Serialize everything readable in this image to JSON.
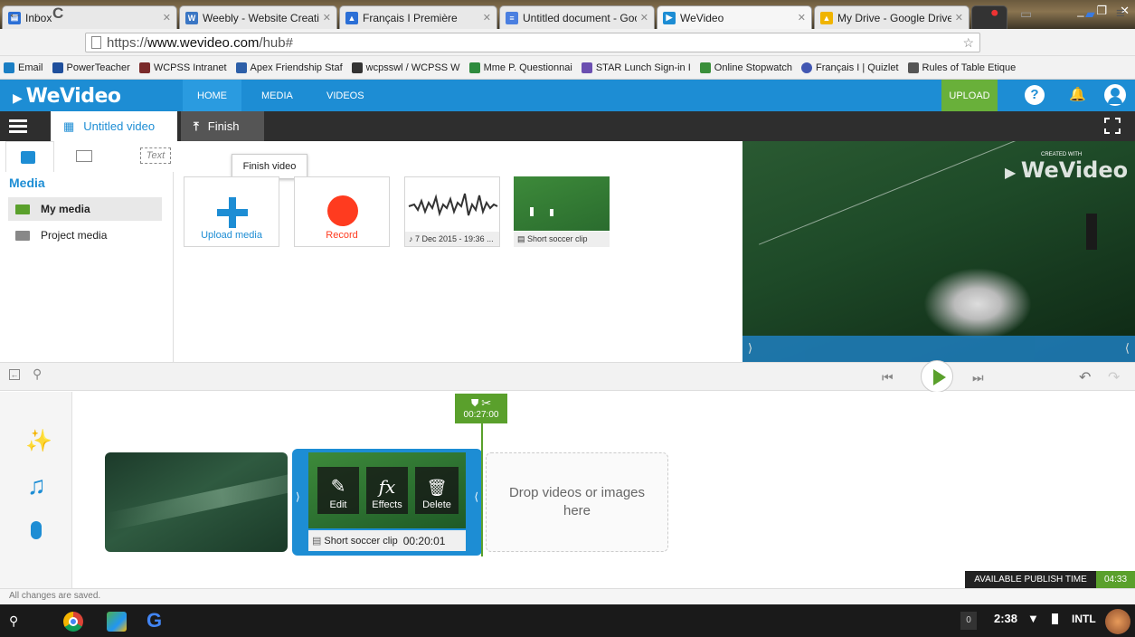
{
  "browser": {
    "tabs": [
      {
        "title": "Inbox",
        "color": "#2b6fd6"
      },
      {
        "title": "Weebly - Website Creati",
        "color": "#3a76c4"
      },
      {
        "title": "Français I Première",
        "color": "#2b6fd6"
      },
      {
        "title": "Untitled document - Goo",
        "color": "#4a7fe0"
      },
      {
        "title": "WeVideo",
        "color": "#1d8dd4"
      },
      {
        "title": "My Drive - Google Drive",
        "color": "#f0b400"
      }
    ],
    "url_prefix": "https://",
    "url_domain": "www.wevideo.com",
    "url_path": "/hub#",
    "bookmarks": [
      {
        "label": "Email",
        "color": "#1b7fc4"
      },
      {
        "label": "PowerTeacher",
        "color": "#1f4f9c"
      },
      {
        "label": "WCPSS Intranet",
        "color": "#7a2b2b"
      },
      {
        "label": "Apex Friendship Staf",
        "color": "#2d5fa8"
      },
      {
        "label": "wcpsswl / WCPSS W",
        "color": "#333333"
      },
      {
        "label": "Mme P. Questionnai",
        "color": "#2e8b3e"
      },
      {
        "label": "STAR Lunch Sign-in I",
        "color": "#6b4fb0"
      },
      {
        "label": "Online Stopwatch",
        "color": "#3a8f3a"
      },
      {
        "label": "Français I | Quizlet",
        "color": "#4257b2"
      },
      {
        "label": "Rules of Table Etique",
        "color": "#555555"
      }
    ]
  },
  "app": {
    "logo": "WeVideo",
    "nav": [
      "HOME",
      "MEDIA",
      "VIDEOS"
    ],
    "upload_label": "UPLOAD",
    "project_title": "Untitled video",
    "finish_label": "Finish",
    "tooltip": "Finish video",
    "media_heading": "Media",
    "media_tab_text": "Text",
    "sidebar_items": [
      "My media",
      "Project media"
    ],
    "tiles": {
      "upload": "Upload media",
      "record": "Record",
      "audio": "7 Dec 2015 - 19:36 ...",
      "clip": "Short soccer clip"
    },
    "preview_watermark_small": "CREATED WITH",
    "preview_watermark": "WeVideo",
    "timeline": {
      "playhead_time": "00:27:00",
      "clip_name": "Short soccer clip",
      "clip_duration": "00:20:01",
      "edit": "Edit",
      "effects": "Effects",
      "delete": "Delete",
      "dropzone": "Drop videos or images here"
    },
    "publish_label": "AVAILABLE PUBLISH TIME",
    "publish_time": "04:33",
    "status": "All changes are saved."
  },
  "taskbar": {
    "notification_count": "0",
    "clock": "2:38",
    "keyboard": "INTL"
  },
  "colors": {
    "accent": "#1d8dd4",
    "green": "#5aa02c",
    "record": "#ff3b1f"
  }
}
